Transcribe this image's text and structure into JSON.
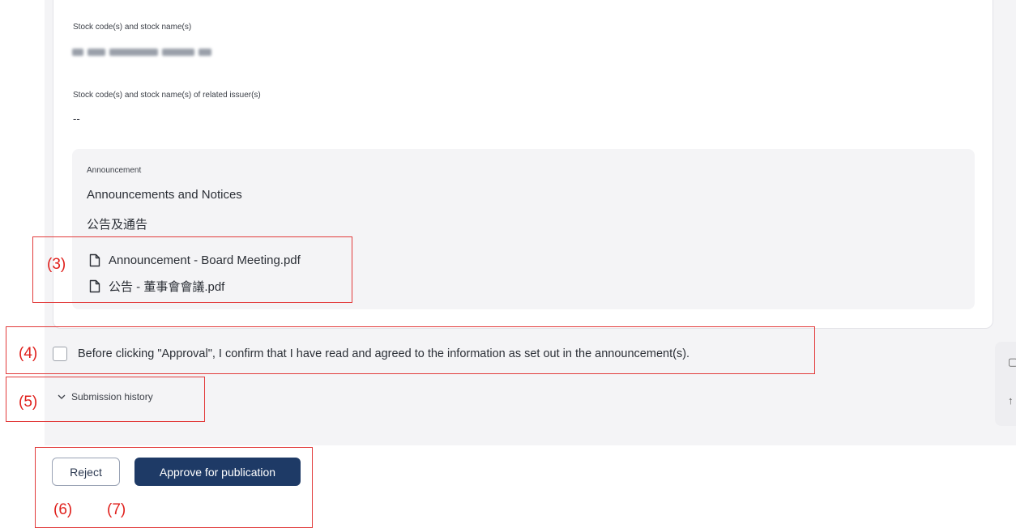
{
  "stock": {
    "label": "Stock code(s) and stock name(s)",
    "related_label": "Stock code(s) and stock name(s) of related issuer(s)",
    "related_value": "--"
  },
  "announcement": {
    "label": "Announcement",
    "title_en": "Announcements and Notices",
    "title_zh": "公告及通告",
    "files": [
      {
        "name": "Announcement - Board Meeting.pdf",
        "icon": "file-icon"
      },
      {
        "name": "公告 - 董事會會議.pdf",
        "icon": "file-icon"
      }
    ]
  },
  "confirm": {
    "text": "Before clicking \"Approval\", I confirm that I have read and agreed to the information as set out in the announcement(s)."
  },
  "history": {
    "label": "Submission history",
    "icon": "chevron-down-icon"
  },
  "actions": {
    "reject": "Reject",
    "approve": "Approve for publication"
  },
  "annotations": {
    "n3": "(3)",
    "n4": "(4)",
    "n5": "(5)",
    "n6": "(6)",
    "n7": "(7)"
  },
  "colors": {
    "primary": "#1e3a66",
    "annotation_red": "#e23b3b"
  }
}
